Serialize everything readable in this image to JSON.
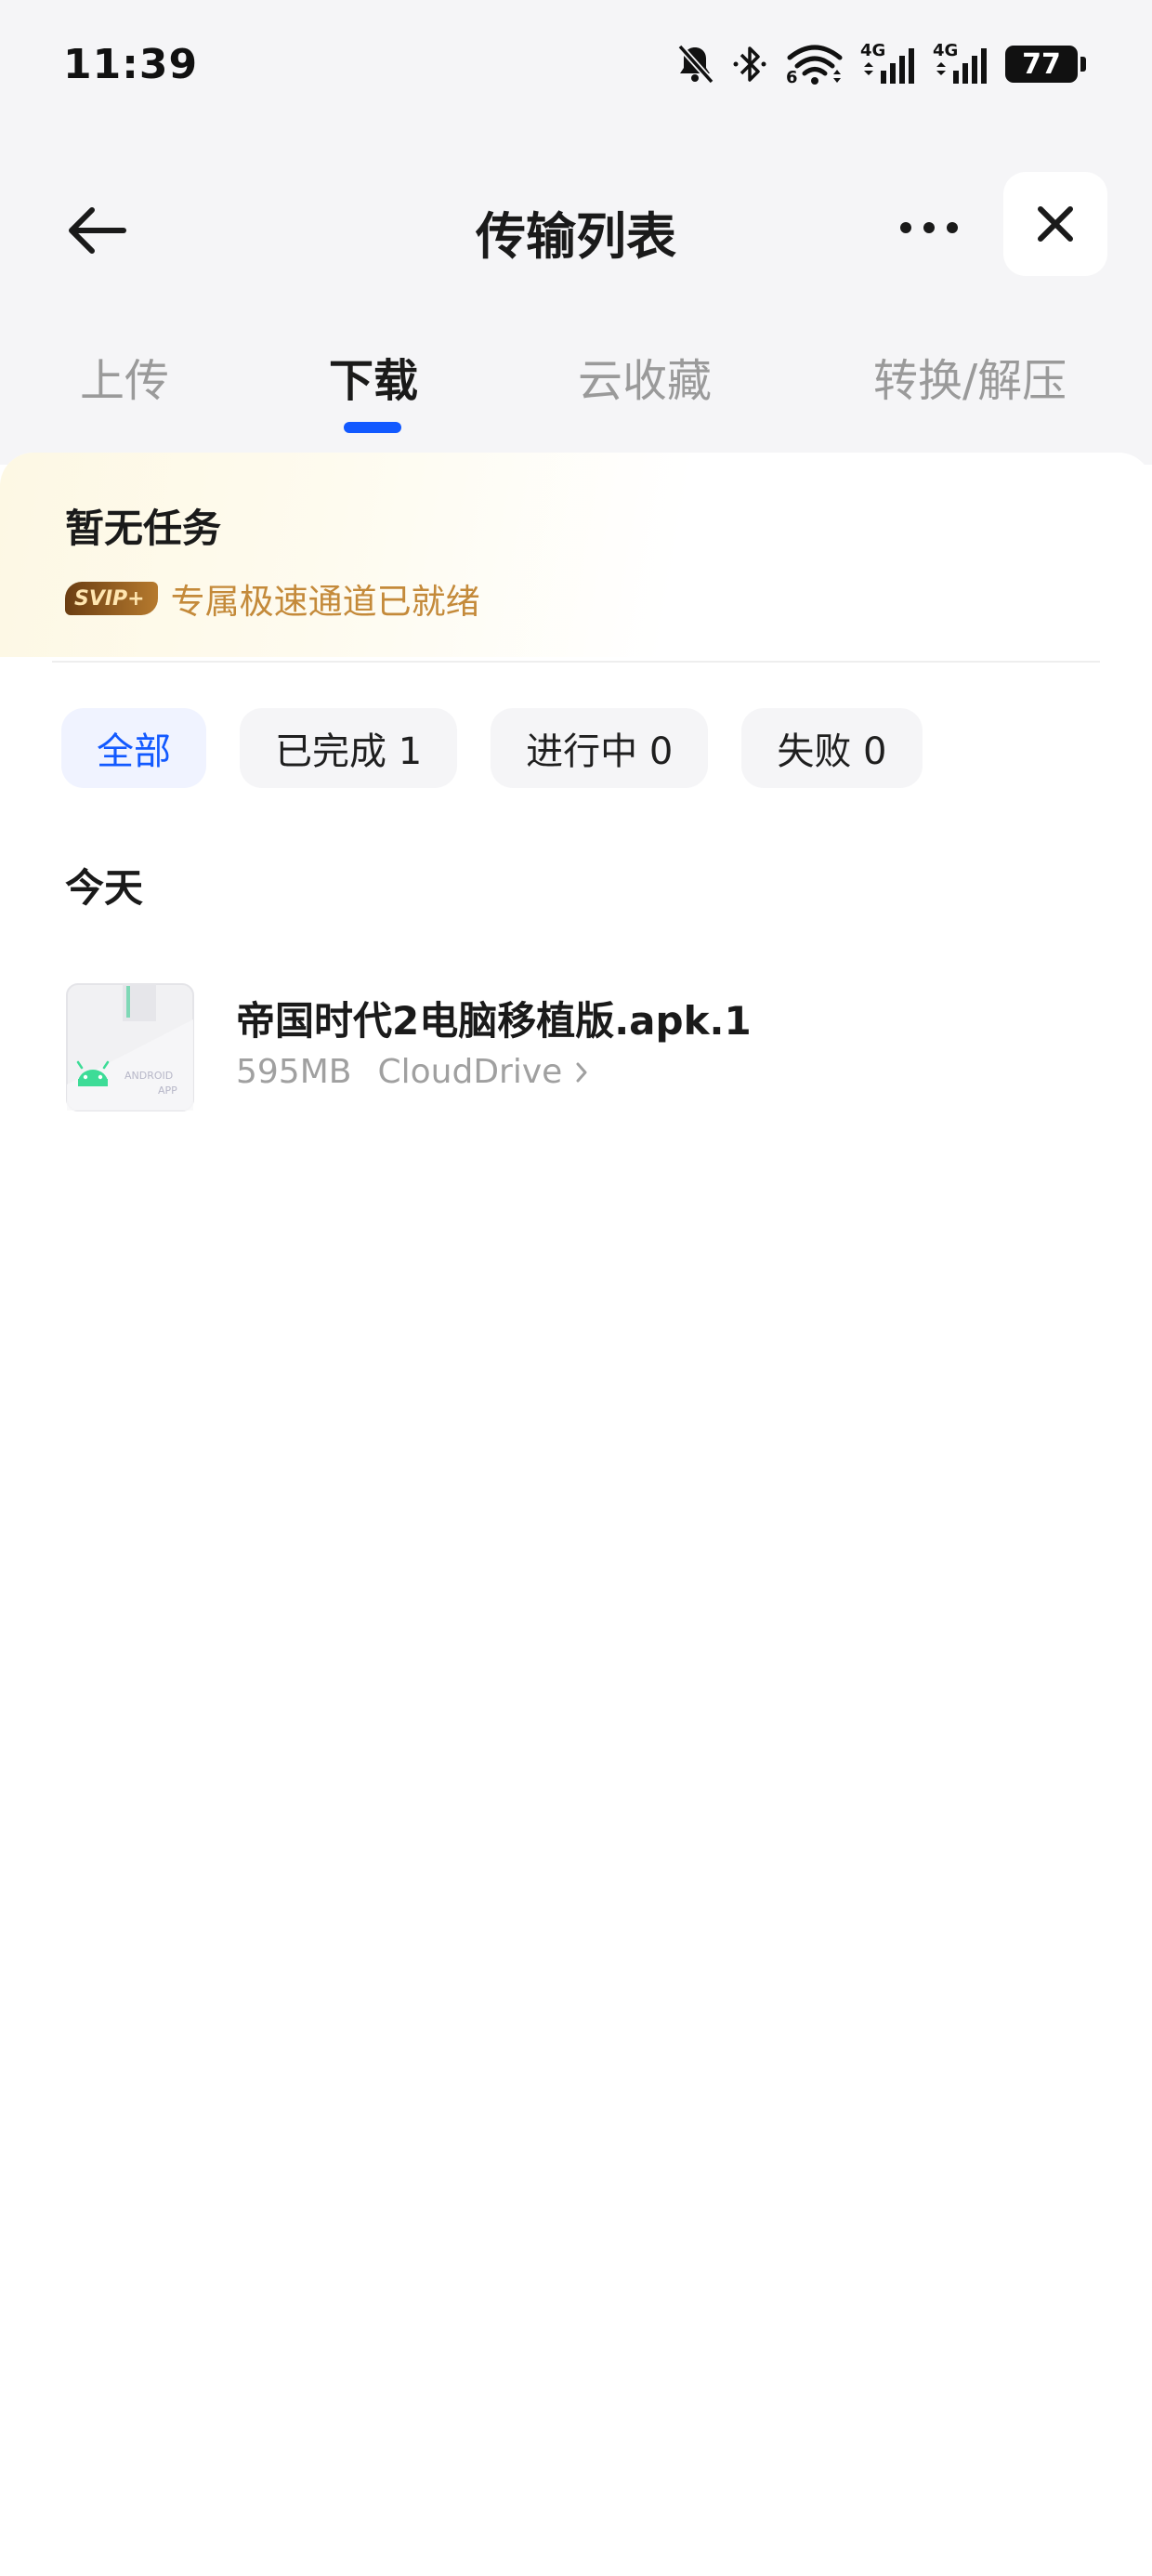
{
  "status_bar": {
    "time": "11:39",
    "signal_1_label": "4G",
    "signal_2_label": "4G",
    "wifi_label": "6",
    "battery": "77",
    "icons": [
      "bell-muted-icon",
      "bluetooth-icon",
      "wifi-icon",
      "signal-icon",
      "signal-icon",
      "battery-icon"
    ]
  },
  "header": {
    "title": "传输列表",
    "icons": [
      "back-arrow-icon",
      "more-icon",
      "close-icon"
    ]
  },
  "tabs": [
    {
      "label": "上传",
      "active": false
    },
    {
      "label": "下载",
      "active": true
    },
    {
      "label": "云收藏",
      "active": false
    },
    {
      "label": "转换/解压",
      "active": false
    }
  ],
  "accent_color": "#1259ff",
  "vip": {
    "status": "暂无任务",
    "badge": "SVIP+",
    "message": "专属极速通道已就绪",
    "color": "#c48a3a"
  },
  "filters": [
    {
      "label": "全部",
      "active": true
    },
    {
      "label": "已完成 1",
      "active": false
    },
    {
      "label": "进行中 0",
      "active": false
    },
    {
      "label": "失败 0",
      "active": false
    }
  ],
  "sections": [
    {
      "title": "今天",
      "items": [
        {
          "name": "帝国时代2电脑移植版.apk.1",
          "size": "595MB",
          "location": "CloudDrive",
          "icon": "android-apk-icon",
          "icon_label_1": "ANDROID",
          "icon_label_2": "APP"
        }
      ]
    }
  ]
}
